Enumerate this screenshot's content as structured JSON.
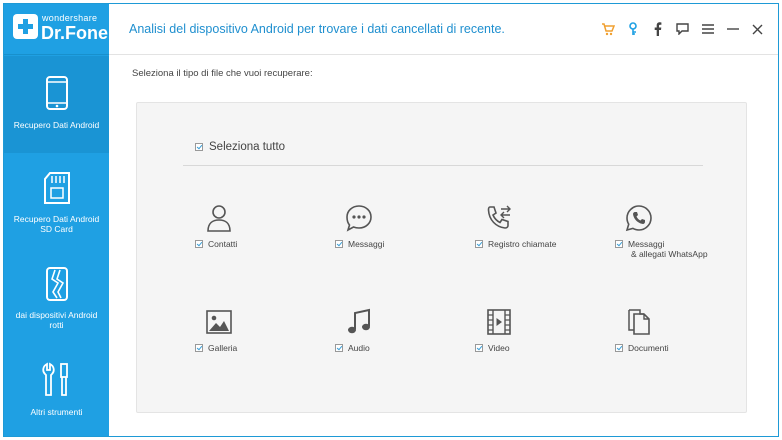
{
  "brand": {
    "top": "wondershare",
    "name": "Dr.Fone"
  },
  "header": {
    "title": "Analisi del dispositivo Android per trovare i dati cancellati di recente."
  },
  "header_icons": [
    "cart-icon",
    "key-icon",
    "facebook-icon",
    "feedback-icon",
    "menu-icon",
    "minimize-icon",
    "close-icon"
  ],
  "sidebar": {
    "items": [
      {
        "label": "Recupero Dati Android",
        "icon": "phone-icon",
        "active": true
      },
      {
        "label": "Recupero Dati Android SD Card",
        "icon": "sd-card-icon",
        "active": false
      },
      {
        "label": "dai dispositivi Android rotti",
        "icon": "broken-phone-icon",
        "active": false
      },
      {
        "label": "Altri strumenti",
        "icon": "tools-icon",
        "active": false
      }
    ]
  },
  "main": {
    "prompt": "Seleziona il tipo di file che vuoi recuperare:",
    "select_all": {
      "label": "Seleziona tutto",
      "checked": true
    },
    "categories": [
      {
        "label": "Contatti",
        "icon": "contacts-icon",
        "checked": true
      },
      {
        "label": "Messaggi",
        "icon": "messages-icon",
        "checked": true
      },
      {
        "label": "Registro chiamate",
        "icon": "call-log-icon",
        "checked": true
      },
      {
        "label": "Messaggi",
        "label2": "& allegati WhatsApp",
        "icon": "whatsapp-icon",
        "checked": true
      },
      {
        "label": "Galleria",
        "icon": "gallery-icon",
        "checked": true
      },
      {
        "label": "Audio",
        "icon": "audio-icon",
        "checked": true
      },
      {
        "label": "Video",
        "icon": "video-icon",
        "checked": true
      },
      {
        "label": "Documenti",
        "icon": "documents-icon",
        "checked": true
      }
    ]
  },
  "colors": {
    "accent": "#1fa0e3",
    "title": "#1f8fcf",
    "cart": "#f0a030"
  }
}
